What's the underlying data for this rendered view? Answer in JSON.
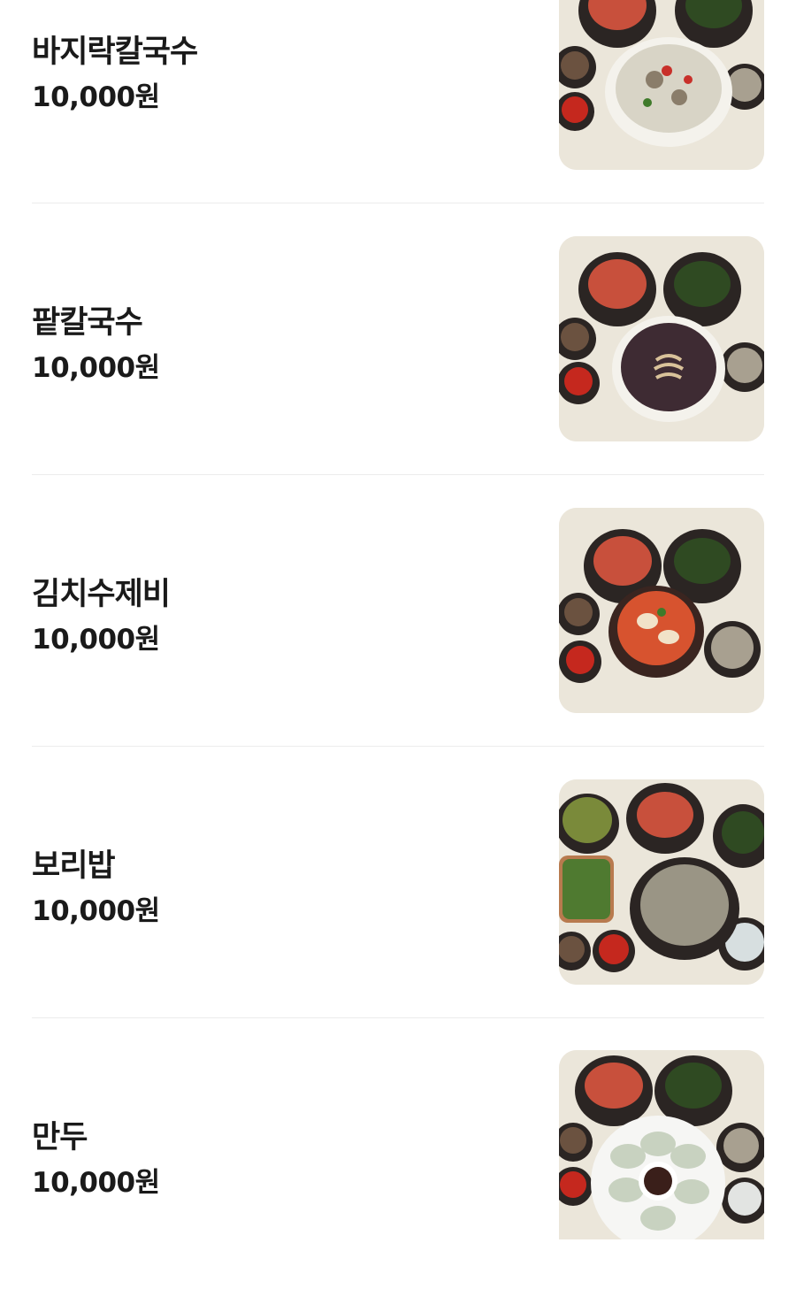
{
  "currency_suffix": "원",
  "menu": {
    "items": [
      {
        "name": "바지락칼국수",
        "price": "10,000",
        "thumbnail": "clam-kalguksu-photo"
      },
      {
        "name": "팥칼국수",
        "price": "10,000",
        "thumbnail": "red-bean-kalguksu-photo"
      },
      {
        "name": "김치수제비",
        "price": "10,000",
        "thumbnail": "kimchi-sujebi-photo"
      },
      {
        "name": "보리밥",
        "price": "10,000",
        "thumbnail": "barley-rice-photo"
      },
      {
        "name": "만두",
        "price": "10,000",
        "thumbnail": "dumpling-photo"
      }
    ]
  },
  "colors": {
    "text": "#1a1a1a",
    "divider": "#ececec",
    "pot": "#2b2523",
    "kimchi": "#c8503c",
    "greens": "#2f4a22",
    "table": "#e9e4d8"
  }
}
